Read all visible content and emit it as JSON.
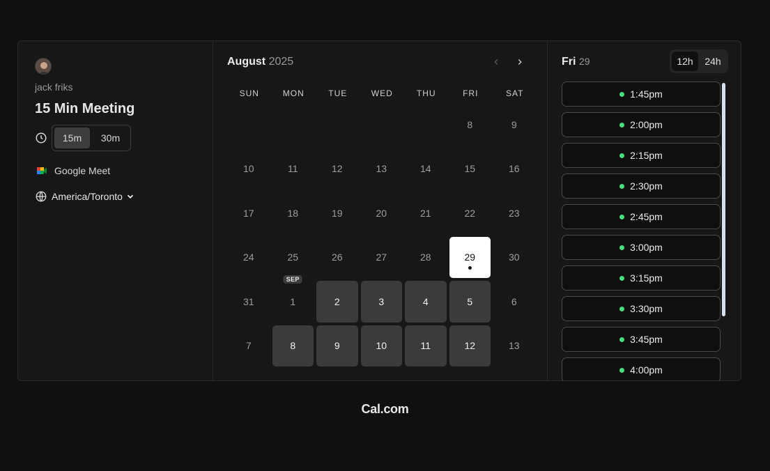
{
  "profile": {
    "host_name": "jack friks",
    "event_title": "15 Min Meeting",
    "durations": [
      "15m",
      "30m"
    ],
    "selected_duration": "15m",
    "location": "Google Meet",
    "timezone": "America/Toronto"
  },
  "calendar": {
    "month": "August",
    "year": "2025",
    "weekdays": [
      "SUN",
      "MON",
      "TUE",
      "WED",
      "THU",
      "FRI",
      "SAT"
    ],
    "days": [
      {
        "label": "",
        "state": "empty"
      },
      {
        "label": "",
        "state": "empty"
      },
      {
        "label": "",
        "state": "empty"
      },
      {
        "label": "",
        "state": "empty"
      },
      {
        "label": "",
        "state": "empty"
      },
      {
        "label": "8",
        "state": "disabled"
      },
      {
        "label": "9",
        "state": "disabled"
      },
      {
        "label": "10",
        "state": "disabled"
      },
      {
        "label": "11",
        "state": "disabled"
      },
      {
        "label": "12",
        "state": "disabled"
      },
      {
        "label": "13",
        "state": "disabled"
      },
      {
        "label": "14",
        "state": "disabled"
      },
      {
        "label": "15",
        "state": "disabled"
      },
      {
        "label": "16",
        "state": "disabled"
      },
      {
        "label": "17",
        "state": "disabled"
      },
      {
        "label": "18",
        "state": "disabled"
      },
      {
        "label": "19",
        "state": "disabled"
      },
      {
        "label": "20",
        "state": "disabled"
      },
      {
        "label": "21",
        "state": "disabled"
      },
      {
        "label": "22",
        "state": "disabled"
      },
      {
        "label": "23",
        "state": "disabled"
      },
      {
        "label": "24",
        "state": "disabled"
      },
      {
        "label": "25",
        "state": "disabled"
      },
      {
        "label": "26",
        "state": "disabled"
      },
      {
        "label": "27",
        "state": "disabled"
      },
      {
        "label": "28",
        "state": "disabled"
      },
      {
        "label": "29",
        "state": "selected"
      },
      {
        "label": "30",
        "state": "disabled"
      },
      {
        "label": "31",
        "state": "disabled"
      },
      {
        "label": "1",
        "state": "disabled",
        "badge": "SEP"
      },
      {
        "label": "2",
        "state": "available"
      },
      {
        "label": "3",
        "state": "available"
      },
      {
        "label": "4",
        "state": "available"
      },
      {
        "label": "5",
        "state": "available"
      },
      {
        "label": "6",
        "state": "disabled"
      },
      {
        "label": "7",
        "state": "disabled"
      },
      {
        "label": "8",
        "state": "available"
      },
      {
        "label": "9",
        "state": "available"
      },
      {
        "label": "10",
        "state": "available"
      },
      {
        "label": "11",
        "state": "available"
      },
      {
        "label": "12",
        "state": "available"
      },
      {
        "label": "13",
        "state": "disabled"
      }
    ]
  },
  "timeslots": {
    "day_of_week": "Fri",
    "day_number": "29",
    "formats": [
      "12h",
      "24h"
    ],
    "selected_format": "12h",
    "slots": [
      "1:45pm",
      "2:00pm",
      "2:15pm",
      "2:30pm",
      "2:45pm",
      "3:00pm",
      "3:15pm",
      "3:30pm",
      "3:45pm",
      "4:00pm"
    ],
    "available_dot_color": "#4ade80"
  },
  "footer": {
    "brand": "Cal.com"
  }
}
